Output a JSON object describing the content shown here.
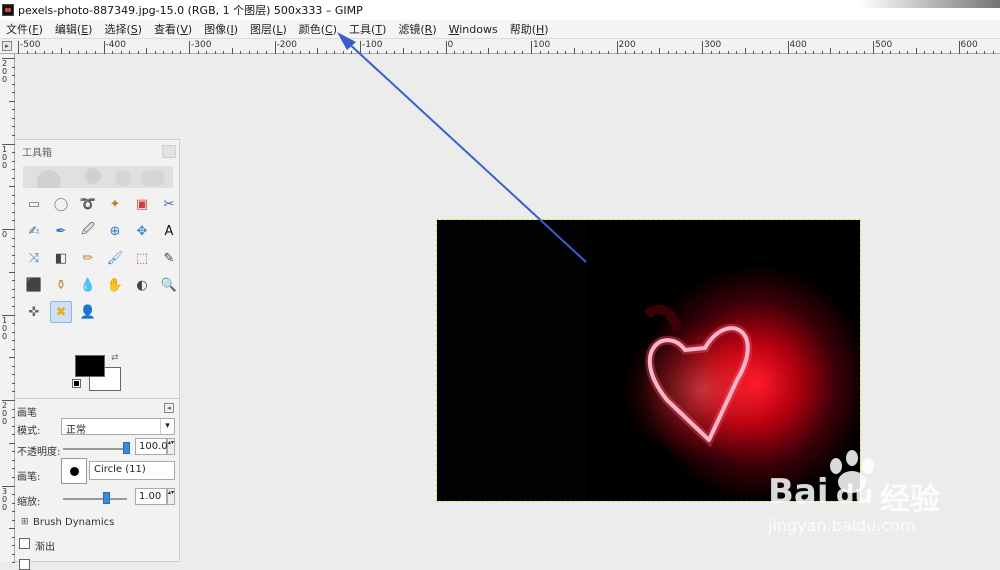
{
  "window": {
    "title": "pexels-photo-887349.jpg-15.0 (RGB, 1 个图层) 500x333 – GIMP"
  },
  "menu": [
    {
      "label": "文件(",
      "key": "F",
      "tail": ")"
    },
    {
      "label": "编辑(",
      "key": "E",
      "tail": ")"
    },
    {
      "label": "选择(",
      "key": "S",
      "tail": ")"
    },
    {
      "label": "查看(",
      "key": "V",
      "tail": ")"
    },
    {
      "label": "图像(",
      "key": "I",
      "tail": ")"
    },
    {
      "label": "图层(",
      "key": "L",
      "tail": ")"
    },
    {
      "label": "颜色(",
      "key": "C",
      "tail": ")"
    },
    {
      "label": "工具(",
      "key": "T",
      "tail": ")"
    },
    {
      "label": "滤镜(",
      "key": "R",
      "tail": ")"
    },
    {
      "label": "",
      "key": "W",
      "tail": "indows"
    },
    {
      "label": "帮助(",
      "key": "H",
      "tail": ")"
    }
  ],
  "ruler": {
    "top_labels": [
      "-500",
      "-400",
      "-300",
      "-200",
      "-100",
      "0",
      "100",
      "200",
      "300",
      "400",
      "500",
      "600"
    ],
    "left_labels": [
      "200",
      "100",
      "0",
      "100",
      "200",
      "300"
    ]
  },
  "toolbox": {
    "title": "工具箱",
    "tool_icons": [
      "rect-select-icon",
      "ellipse-select-icon",
      "free-select-icon",
      "fuzzy-select-icon",
      "select-by-color-icon",
      "scissors-icon",
      "foreground-select-icon",
      "paths-icon",
      "color-picker-icon",
      "zoom-lens-icon",
      "measure-icon",
      "move-icon",
      "align-icon",
      "crop-icon",
      "rotate-icon",
      "scale-icon",
      "shear-icon",
      "perspective-icon",
      "flip-icon",
      "cage-icon",
      "warp-icon",
      "text-icon",
      "bucket-fill-icon",
      "blend-icon",
      "pencil-icon",
      "paintbrush-icon",
      "eraser-icon",
      "airbrush-icon",
      "ink-icon",
      "clone-icon",
      "heal-icon",
      "perspective-clone-icon",
      "blur-icon",
      "smudge-icon",
      "dodge-burn-icon",
      "magnify-icon"
    ],
    "tool_glyphs": [
      "▭",
      "◯",
      "➰",
      "✦",
      "▣",
      "✂",
      "✍",
      "✒",
      "🖉",
      "⊕",
      "✥",
      "A",
      "⤨",
      "◧",
      "✏",
      "🖌",
      "⬚",
      "✎",
      "⬛",
      "⚱",
      "💧",
      "✋",
      "◐",
      "🔍",
      "✜",
      "✖",
      "👤"
    ],
    "active_tool": "paintbrush-icon",
    "options_title": "画笔",
    "mode_label": "模式:",
    "mode_value": "正常",
    "opacity_label": "不透明度:",
    "opacity_value": "100.0",
    "brush_label": "画笔:",
    "brush_value": "Circle (11)",
    "size_label": "缩放:",
    "size_value": "1.00",
    "dynamics_label": "Brush Dynamics",
    "fade_label": "渐出"
  },
  "colors": {
    "foreground": "#000000",
    "background": "#ffffff",
    "annotation_arrow": "#3a5fcc"
  },
  "watermark": {
    "brand": "Bai",
    "brand2": "du",
    "suffix": "经验",
    "url": "jingyan.baidu.com"
  }
}
